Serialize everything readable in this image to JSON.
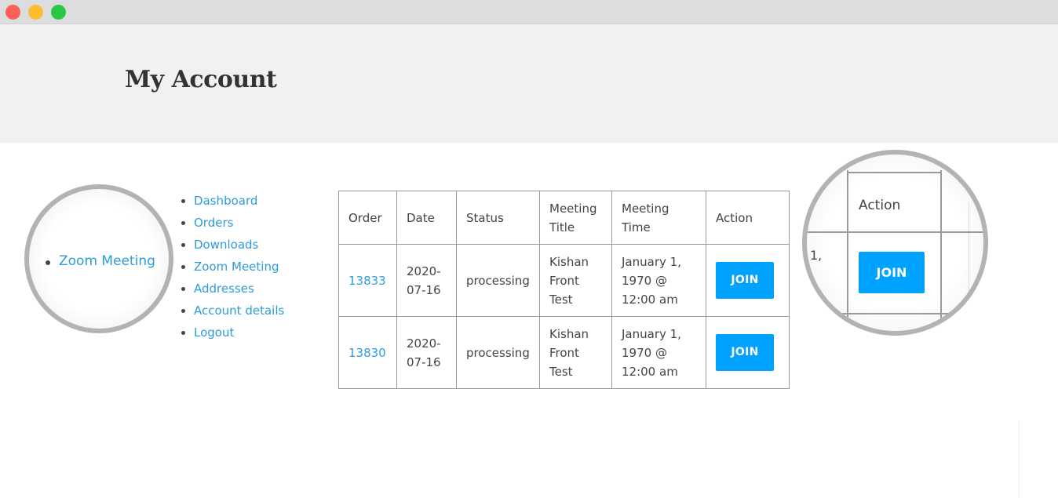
{
  "window": {
    "controls": [
      {
        "name": "close",
        "color": "#fe5f57"
      },
      {
        "name": "minimize",
        "color": "#febc2e"
      },
      {
        "name": "maximize",
        "color": "#28c840"
      }
    ]
  },
  "header": {
    "title": "My Account",
    "background": "#f0f1f3"
  },
  "nav": {
    "items": [
      {
        "label": "Dashboard"
      },
      {
        "label": "Orders"
      },
      {
        "label": "Downloads"
      },
      {
        "label": "Zoom Meeting"
      },
      {
        "label": "Addresses"
      },
      {
        "label": "Account details"
      },
      {
        "label": "Logout"
      }
    ],
    "link_color": "#2d9cdb"
  },
  "zoom_left": {
    "label": "Zoom Meeting"
  },
  "table": {
    "headers": {
      "order": "Order",
      "date": "Date",
      "status": "Status",
      "meeting_title": "Meeting Title",
      "meeting_time": "Meeting Time",
      "action": "Action"
    },
    "rows": [
      {
        "order": "13833",
        "date": "2020-07-16",
        "status": "processing",
        "meeting_title": "Kishan Front Test",
        "meeting_time": "January 1, 1970 @ 12:00 am",
        "action": "JOIN"
      },
      {
        "order": "13830",
        "date": "2020-07-16",
        "status": "processing",
        "meeting_title": "Kishan Front Test",
        "meeting_time": "January 1, 1970 @ 12:00 am",
        "action": "JOIN"
      }
    ],
    "button_color": "#00a2ff"
  },
  "zoom_right": {
    "header": "Action",
    "fragment": "1,",
    "button": "JOIN"
  }
}
